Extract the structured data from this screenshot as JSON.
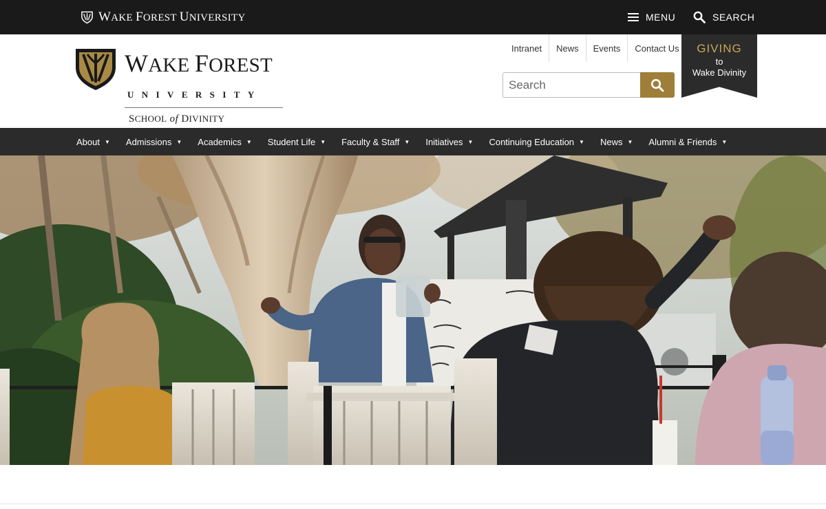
{
  "topbar": {
    "brand_main": "W",
    "brand_small": "AKE ",
    "brand_main2": "F",
    "brand_small2": "OREST ",
    "brand_main3": "U",
    "brand_small3": "NIVERSITY",
    "menu_label": "MENU",
    "search_label": "SEARCH",
    "menu_icon": "hamburger-icon",
    "search_icon": "search-icon"
  },
  "logo": {
    "w": "W",
    "ake": "AKE ",
    "f": "F",
    "orest": "OREST",
    "university": "UNIVERSITY",
    "school_s": "S",
    "school_rest": "CHOOL",
    "of": " of ",
    "divinity_d": "D",
    "divinity_rest": "IVINITY"
  },
  "quicklinks": [
    "Intranet",
    "News",
    "Events",
    "Contact Us"
  ],
  "search": {
    "placeholder": "Search",
    "icon": "search-icon"
  },
  "giving": {
    "title": "GIVING",
    "line2": "to",
    "line3": "Wake Divinity"
  },
  "nav": [
    "About",
    "Admissions",
    "Academics",
    "Student Life",
    "Faculty & Staff",
    "Initiatives",
    "Continuing Education",
    "News",
    "Alumni & Friends"
  ],
  "colors": {
    "topbar": "#1a1a1a",
    "nav": "#2b2b2b",
    "gold": "#9e7e38",
    "giving_gold": "#c8a55a"
  }
}
